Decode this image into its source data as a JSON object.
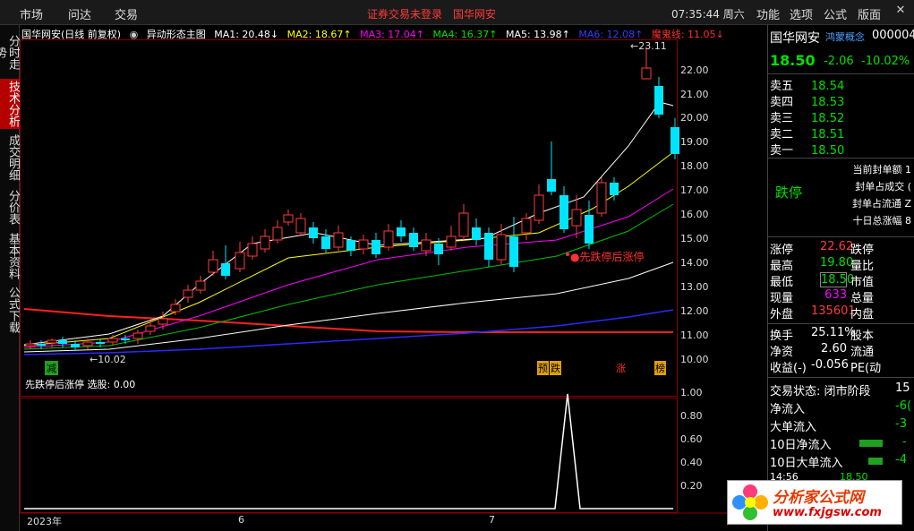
{
  "topbar": {
    "menu": [
      "市场",
      "问达",
      "交易"
    ],
    "alert": "证券交易未登录　国华网安",
    "time": "07:35:44 周六",
    "right_menu": [
      "功能",
      "选项",
      "公式",
      "版面"
    ]
  },
  "side_tabs": [
    "分时走势",
    "技术分析",
    "成交明细",
    "分价表",
    "基本资料",
    "公式下载"
  ],
  "chart": {
    "title": "国华网安(日线 前复权)",
    "formula": "异动形态主图",
    "ma1": "MA1: 20.48↓",
    "ma2": "MA2: 18.67↑",
    "ma3": "MA3: 17.04↑",
    "ma4": "MA4: 16.37↑",
    "ma5": "MA5: 13.98↑",
    "ma6": "MA6: 12.08↑",
    "mogui": "魔鬼线: 11.05↓",
    "high_label": "←23.11",
    "low_label": "←10.02",
    "signal_text": "●先跌停后涨停",
    "marker_jian": "减",
    "marker_yu": "预",
    "marker_die": "跌",
    "marker_zhang": "涨",
    "marker_bang": "榜",
    "price_ticks": [
      "22.00",
      "21.00",
      "20.00",
      "19.00",
      "18.00",
      "17.00",
      "16.00",
      "15.00",
      "14.00",
      "13.00",
      "12.00",
      "11.00",
      "10.00"
    ],
    "sub_title": "先跌停后涨停 选股: 0.00",
    "sub_ticks": [
      "1.00",
      "0.80",
      "0.60",
      "0.40",
      "0.20"
    ],
    "date_labels": [
      "2023年",
      "6",
      "7"
    ],
    "colors": {
      "up": "#ff3b3b",
      "down": "#00e5ff",
      "ma1": "#ffffff",
      "ma2": "#ffff00",
      "ma3": "#ff00ff",
      "ma4": "#00c000",
      "ma5": "#ffffff",
      "ma6": "#2a2aff",
      "mogui": "#ff2020"
    }
  },
  "right_panel": {
    "name": "国华网安",
    "code": "000004",
    "concept": "鸿蒙概念",
    "price": "18.50",
    "change": "-2.06",
    "pct": "-10.02%",
    "asks": [
      {
        "label": "卖五",
        "price": "18.54"
      },
      {
        "label": "卖四",
        "price": "18.53"
      },
      {
        "label": "卖三",
        "price": "18.52"
      },
      {
        "label": "卖二",
        "price": "18.51"
      },
      {
        "label": "卖一",
        "price": "18.50"
      }
    ],
    "limit_status": "跌停",
    "limit_info": [
      "当前封单额 1",
      "封单占成交 (",
      "封单占流通 Z",
      "十日总涨幅 8"
    ],
    "stats": [
      {
        "k": "涨停",
        "v": "22.62",
        "k2": "跌停"
      },
      {
        "k": "最高",
        "v": "19.80",
        "k2": "量比"
      },
      {
        "k": "最低",
        "v": "18.50",
        "k2": "市值"
      },
      {
        "k": "现量",
        "v": "633",
        "k2": "总量"
      },
      {
        "k": "外盘",
        "v": "135601",
        "k2": "内盘"
      }
    ],
    "stats2": [
      {
        "k": "换手",
        "v": "25.11%",
        "k2": "股本"
      },
      {
        "k": "净资",
        "v": "2.60",
        "k2": "流通"
      },
      {
        "k": "收益(-)",
        "v": "-0.056",
        "k2": "PE(动"
      }
    ],
    "trade_status": "交易状态: 闭市阶段",
    "trade_status_num": "15",
    "flows": [
      {
        "k": "净流入",
        "v": "-6("
      },
      {
        "k": "大单流入",
        "v": "-3"
      },
      {
        "k": "10日净流入",
        "v": "-"
      },
      {
        "k": "10日大单流入",
        "v": "-4"
      }
    ],
    "tail_time": "14:56",
    "tail_price": "18.50"
  },
  "watermark": {
    "title": "分析家公式网",
    "url": "www.fxjgsw.com"
  }
}
